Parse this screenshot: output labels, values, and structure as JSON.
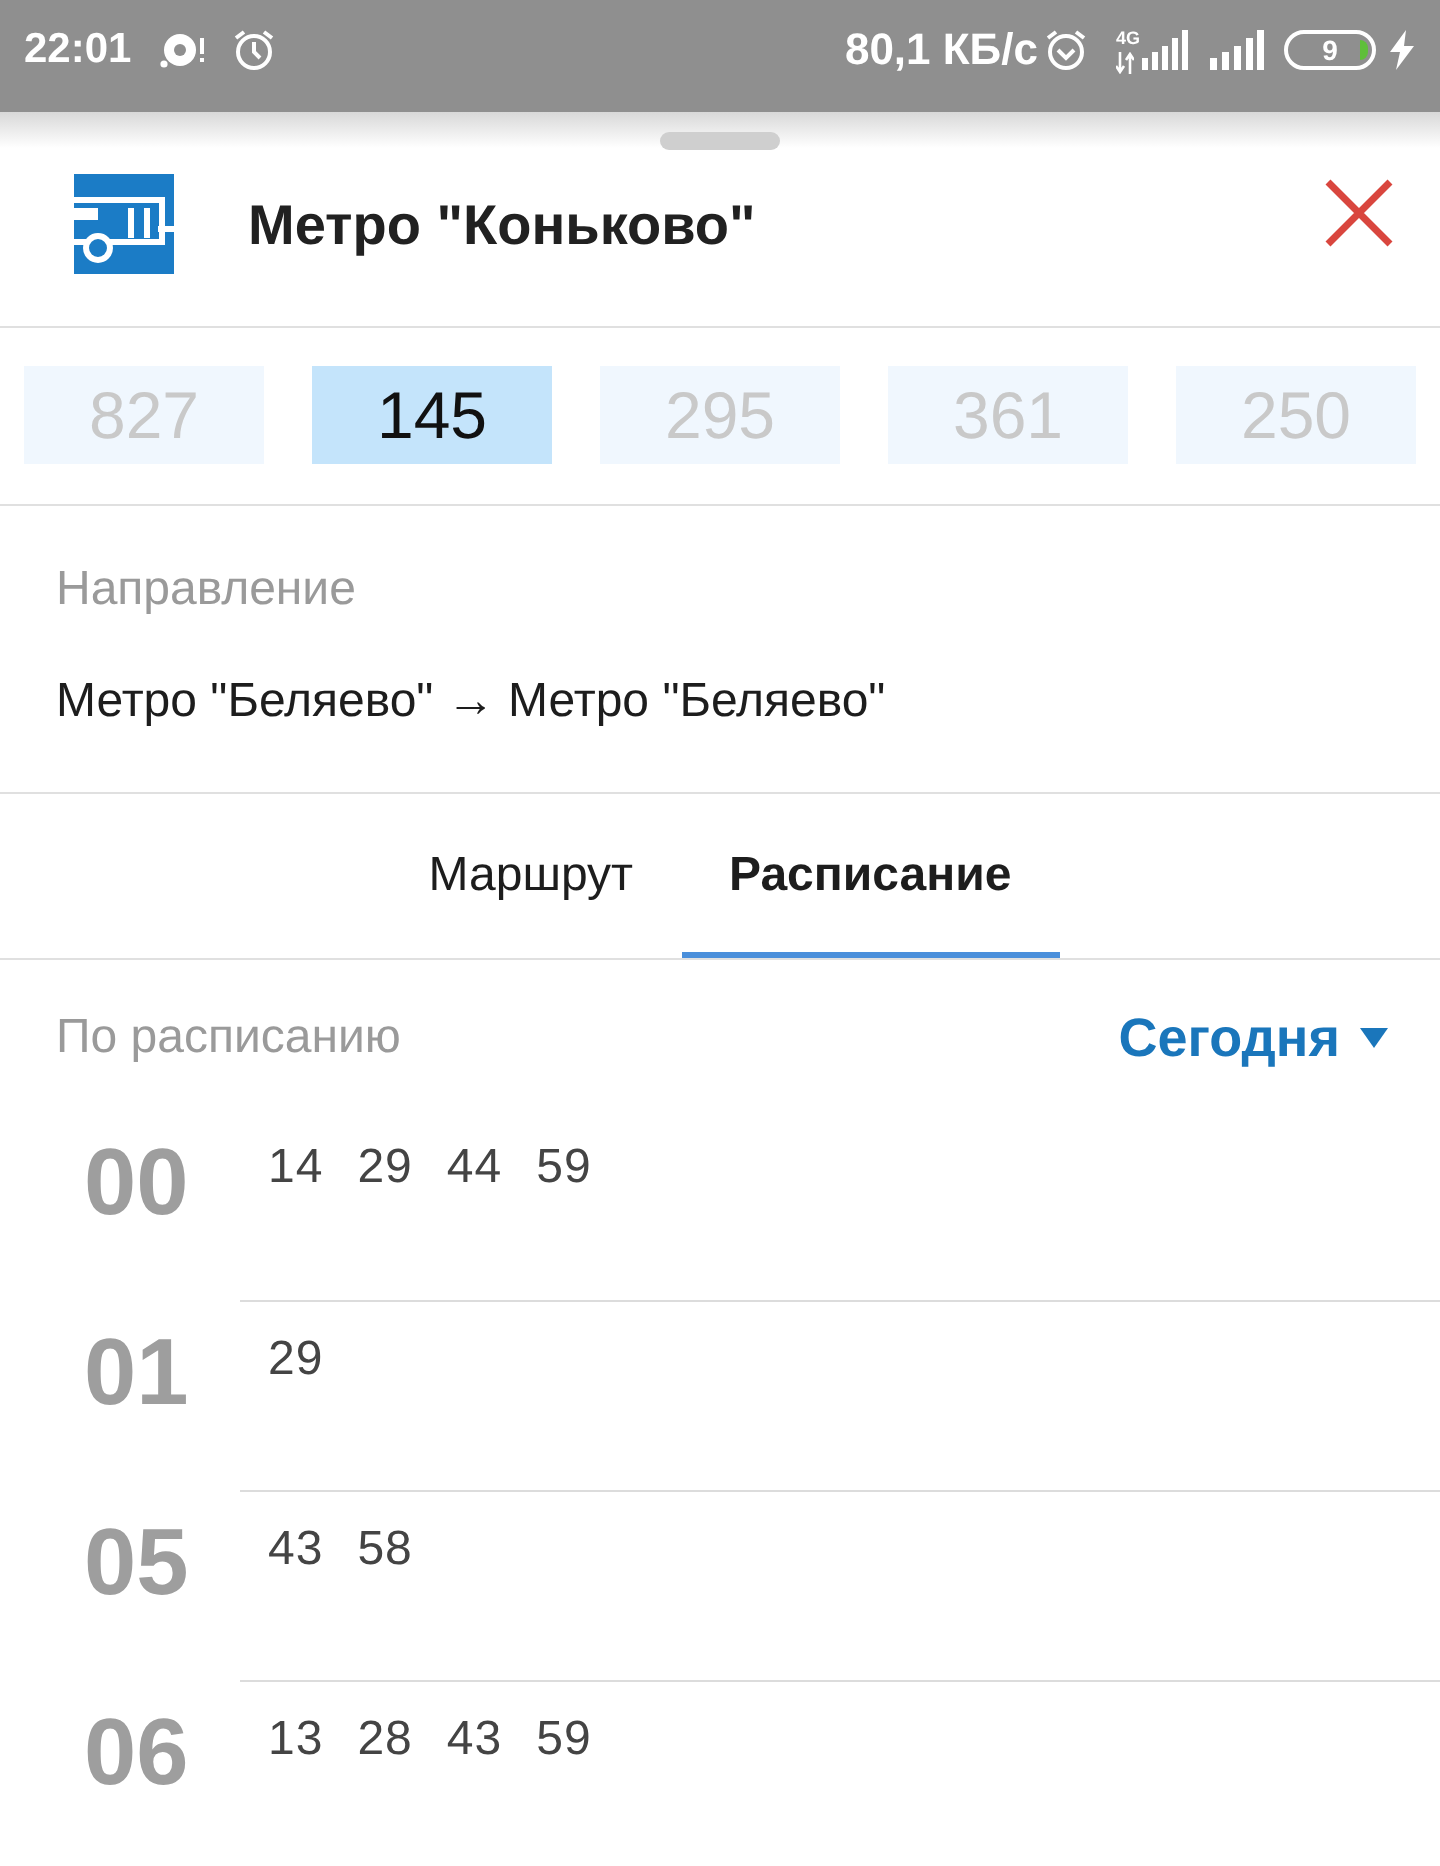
{
  "status_bar": {
    "time": "22:01",
    "speed": "80,1 КБ/с",
    "network_type": "4G",
    "battery": "9"
  },
  "header": {
    "title": "Метро \"Коньково\""
  },
  "routes": [
    {
      "number": "827",
      "selected": false
    },
    {
      "number": "145",
      "selected": true
    },
    {
      "number": "295",
      "selected": false
    },
    {
      "number": "361",
      "selected": false
    },
    {
      "number": "250",
      "selected": false
    }
  ],
  "direction": {
    "label": "Направление",
    "value": "Метро \"Беляево\" → Метро \"Беляево\""
  },
  "tabs": [
    {
      "label": "Маршрут",
      "selected": false
    },
    {
      "label": "Расписание",
      "selected": true
    }
  ],
  "schedule": {
    "label": "По расписанию",
    "day": "Сегодня",
    "rows": [
      {
        "hour": "00",
        "minutes": [
          "14",
          "29",
          "44",
          "59"
        ]
      },
      {
        "hour": "01",
        "minutes": [
          "29"
        ]
      },
      {
        "hour": "05",
        "minutes": [
          "43",
          "58"
        ]
      },
      {
        "hour": "06",
        "minutes": [
          "13",
          "28",
          "43",
          "59"
        ]
      }
    ]
  }
}
